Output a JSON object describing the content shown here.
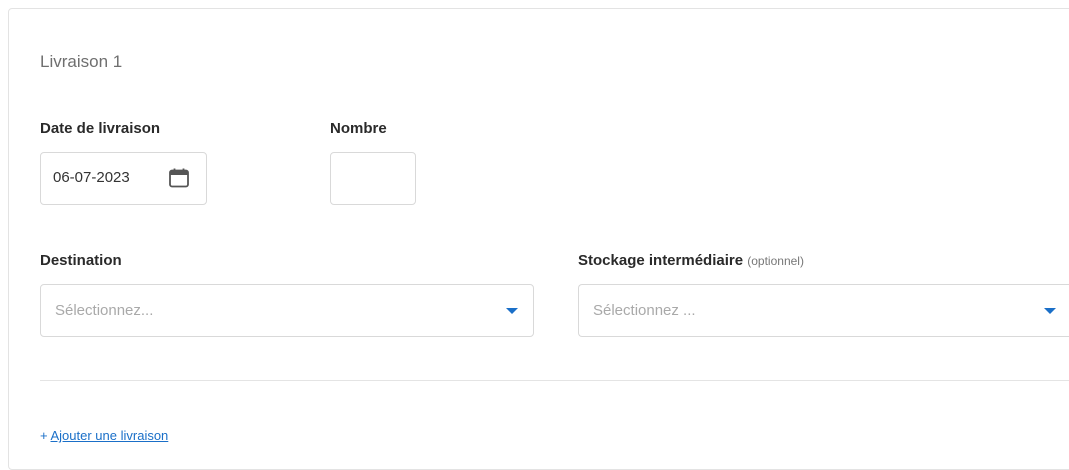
{
  "section_title": "Livraison 1",
  "date_field": {
    "label": "Date de livraison",
    "value": "06-07-2023",
    "icon": "calendar-icon"
  },
  "nombre_field": {
    "label": "Nombre",
    "value": ""
  },
  "destination": {
    "label": "Destination",
    "placeholder": "Sélectionnez...",
    "icon": "caret-down-icon"
  },
  "stockage": {
    "label": "Stockage intermédiaire",
    "optional": "(optionnel)",
    "placeholder": "Sélectionnez ...",
    "icon": "caret-down-icon"
  },
  "add_link": {
    "prefix": "+",
    "label": "Ajouter une livraison"
  },
  "colors": {
    "accent": "#1a6fc8",
    "border": "#d9d9d9",
    "placeholder": "#a9a9a9"
  }
}
